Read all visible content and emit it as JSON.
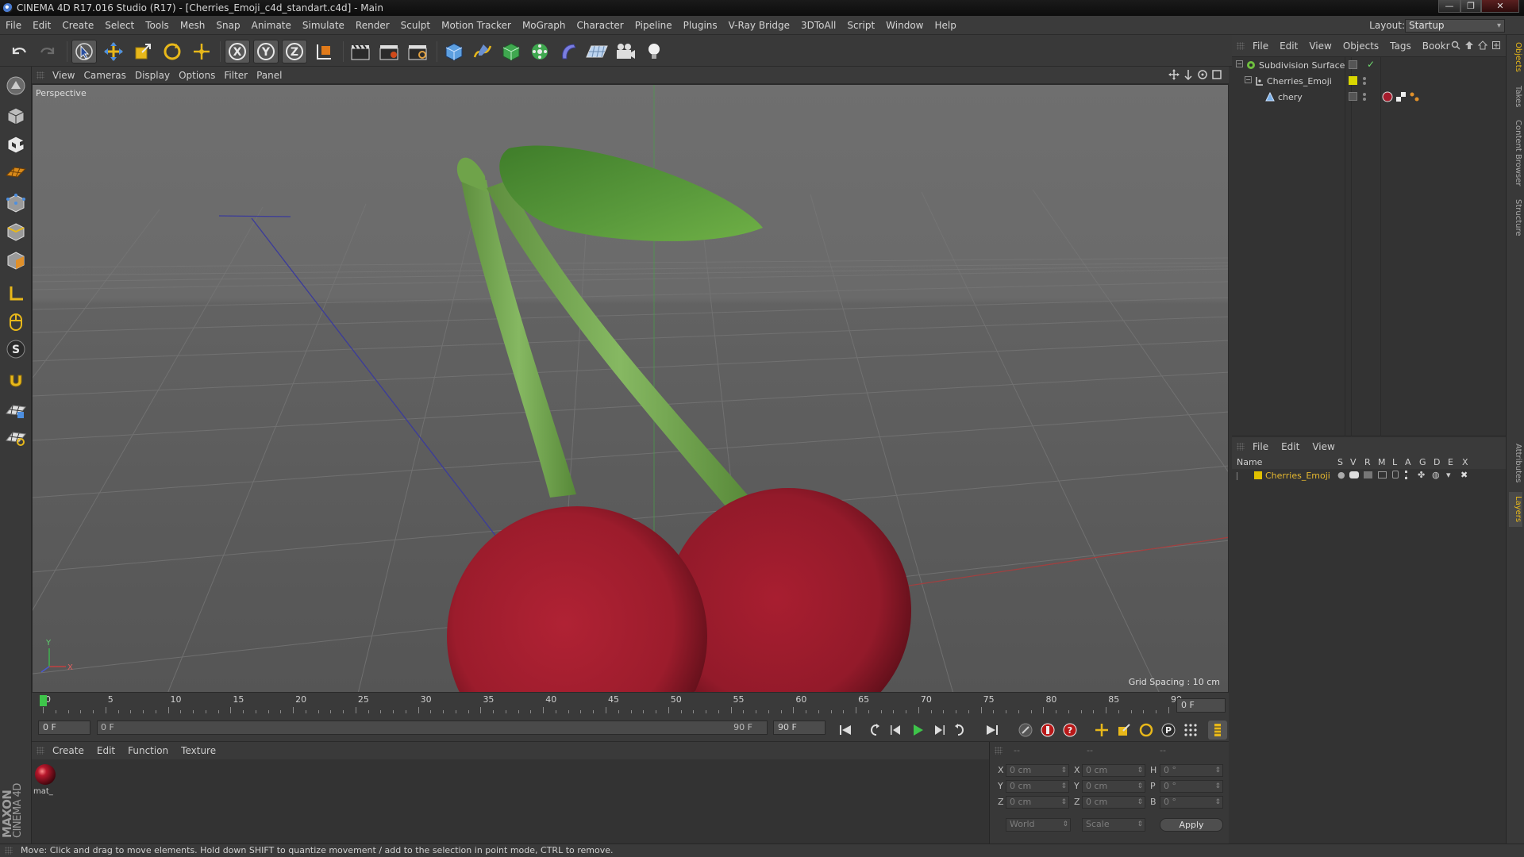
{
  "window": {
    "title": "CINEMA 4D R17.016 Studio (R17) - [Cherries_Emoji_c4d_standart.c4d] - Main",
    "controls": [
      "—",
      "❐",
      "✕"
    ]
  },
  "menubar": {
    "items": [
      "File",
      "Edit",
      "Create",
      "Select",
      "Tools",
      "Mesh",
      "Snap",
      "Animate",
      "Simulate",
      "Render",
      "Sculpt",
      "Motion Tracker",
      "MoGraph",
      "Character",
      "Pipeline",
      "Plugins",
      "V-Ray Bridge",
      "3DToAll",
      "Script",
      "Window",
      "Help"
    ],
    "layout_label": "Layout:",
    "layout_value": "Startup"
  },
  "viewport": {
    "menu": [
      "View",
      "Cameras",
      "Display",
      "Options",
      "Filter",
      "Panel"
    ],
    "label": "Perspective",
    "grid_spacing": "Grid Spacing : 10 cm",
    "axis_y": "Y",
    "axis_x": "X",
    "colors": {
      "cherry": "#a31c2c",
      "stem": "#6fa34a",
      "leaf": "#5a9a3c",
      "background": "#595959"
    }
  },
  "timeline": {
    "ticks": [
      "0",
      "5",
      "10",
      "15",
      "20",
      "25",
      "30",
      "35",
      "40",
      "45",
      "50",
      "55",
      "60",
      "65",
      "70",
      "75",
      "80",
      "85",
      "90"
    ],
    "current_frame_field": "0 F",
    "start_field": "0 F",
    "range_start": "0 F",
    "range_end": "90 F",
    "end_field": "90 F"
  },
  "material_manager": {
    "menu": [
      "Create",
      "Edit",
      "Function",
      "Texture"
    ],
    "materials": [
      {
        "name": "mat_"
      }
    ]
  },
  "coordinates": {
    "headers": [
      "--",
      "--",
      "--"
    ],
    "rows": [
      {
        "l1": "X",
        "v1": "0 cm",
        "l2": "X",
        "v2": "0 cm",
        "l3": "H",
        "v3": "0 °"
      },
      {
        "l1": "Y",
        "v1": "0 cm",
        "l2": "Y",
        "v2": "0 cm",
        "l3": "P",
        "v3": "0 °"
      },
      {
        "l1": "Z",
        "v1": "0 cm",
        "l2": "Z",
        "v2": "0 cm",
        "l3": "B",
        "v3": "0 °"
      }
    ],
    "mode1": "World",
    "mode2": "Scale",
    "apply": "Apply"
  },
  "object_manager": {
    "menu": [
      "File",
      "Edit",
      "View",
      "Objects",
      "Tags",
      "Bookr"
    ],
    "objects": [
      {
        "name": "Subdivision Surface",
        "color": "#6fbf3f"
      },
      {
        "name": "Cherries_Emoji",
        "color": "#d9d600"
      },
      {
        "name": "chery",
        "color": "#cfcfcf"
      }
    ]
  },
  "layer_manager": {
    "menu": [
      "File",
      "Edit",
      "View"
    ],
    "columns": [
      "Name",
      "S",
      "V",
      "R",
      "M",
      "L",
      "A",
      "G",
      "D",
      "E",
      "X"
    ],
    "layers": [
      {
        "name": "Cherries_Emoji",
        "color": "#e0c000"
      }
    ]
  },
  "side_tabs": [
    "Objects",
    "Takes",
    "Content Browser",
    "Structure",
    "Attributes",
    "Layers"
  ],
  "logo": {
    "brand": "MAXON",
    "product": "CINEMA 4D"
  },
  "status": "Move: Click and drag to move elements. Hold down SHIFT to quantize movement / add to the selection in point mode, CTRL to remove."
}
